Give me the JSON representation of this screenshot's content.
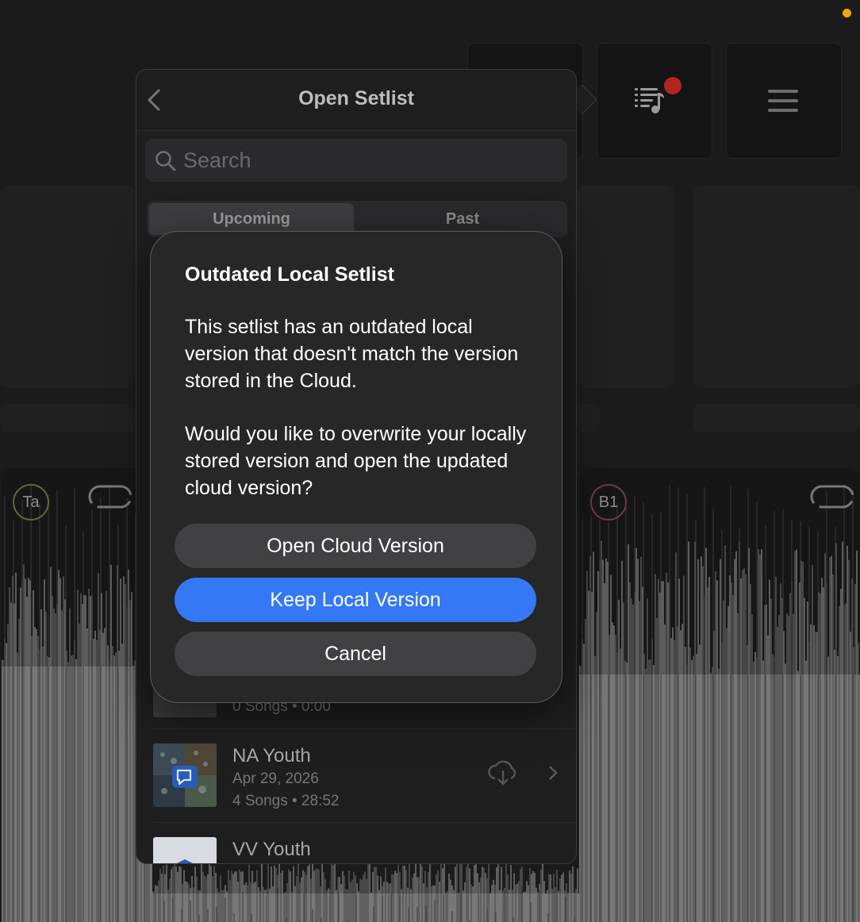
{
  "background": {
    "decks": [
      {
        "label": "Ta",
        "ring_color": "#5a6b3a"
      },
      {
        "label": "B1",
        "ring_color": "#6e3a45"
      }
    ],
    "colors": {
      "record_indicator": "#f5a30a",
      "badge": "#b3261e"
    }
  },
  "popover": {
    "title": "Open Setlist",
    "search": {
      "placeholder": "Search",
      "value": ""
    },
    "tabs": [
      {
        "label": "Upcoming",
        "selected": true
      },
      {
        "label": "Past",
        "selected": false
      }
    ],
    "setlists": [
      {
        "title": "",
        "date": "",
        "meta": "0 Songs • 0:00"
      },
      {
        "title": "NA Youth",
        "date": "Apr 29, 2026",
        "meta": "4 Songs • 28:52"
      },
      {
        "title": "VV Youth",
        "date": "",
        "meta": ""
      }
    ]
  },
  "alert": {
    "title": "Outdated Local Setlist",
    "message": "This setlist has an outdated local version that doesn't match the version stored in the Cloud.",
    "question": "Would you like to overwrite your locally stored version and open the updated cloud version?",
    "buttons": {
      "open_cloud": "Open Cloud Version",
      "keep_local": "Keep Local Version",
      "cancel": "Cancel"
    },
    "accent_color": "#3478f6"
  }
}
